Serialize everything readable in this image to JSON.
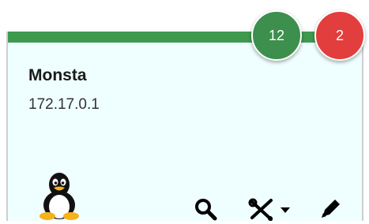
{
  "host": {
    "name": "Monsta",
    "ip": "172.17.0.1"
  },
  "badges": {
    "green_count": "12",
    "red_count": "2"
  },
  "colors": {
    "card_background": "#effefe",
    "status_bar": "#3f9a4f",
    "badge_green": "#3c8f4c",
    "badge_red": "#e23e3e"
  },
  "icons": {
    "os": "linux-tux-icon",
    "search": "search-icon",
    "tools": "tools-dropdown-icon",
    "edit": "pencil-icon"
  }
}
